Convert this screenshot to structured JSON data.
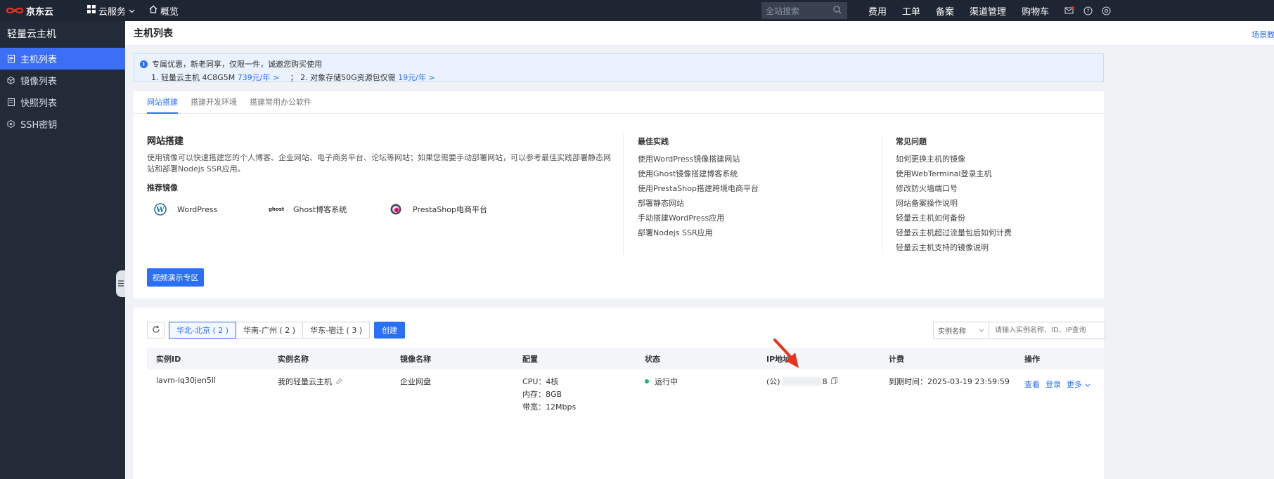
{
  "topbar": {
    "brand": "京东云",
    "cloud_services": "云服务",
    "overview": "概览",
    "search_placeholder": "全站搜索",
    "links": [
      "费用",
      "工单",
      "备案",
      "渠道管理",
      "购物车"
    ]
  },
  "sidebar": {
    "title": "轻量云主机",
    "items": [
      {
        "label": "主机列表",
        "icon": "host-list-icon"
      },
      {
        "label": "镜像列表",
        "icon": "image-icon"
      },
      {
        "label": "快照列表",
        "icon": "snapshot-icon"
      },
      {
        "label": "SSH密钥",
        "icon": "key-icon"
      }
    ]
  },
  "header": {
    "title": "主机列表",
    "scene_link": "场景教程"
  },
  "notice": {
    "line1": "专属优惠，新老同享，仅限一件，诚邀您购买使用",
    "item1_prefix": "1. 轻量云主机 4C8G5M ",
    "item1_price": "739元/年 >",
    "sep": "；",
    "item2_prefix": " 2. 对象存储50G资源包仅需 ",
    "item2_price": "19元/年 >"
  },
  "tabs": [
    "网站搭建",
    "搭建开发环境",
    "搭建常用办公软件"
  ],
  "website": {
    "title": "网站搭建",
    "desc": "使用镜像可以快速搭建您的个人博客、企业网站、电子商务平台、论坛等网站；如果您需要手动部署网站，可以参考最佳实践部署静态网站和部署Nodejs SSR应用。",
    "recommend_title": "推荐镜像",
    "images": [
      {
        "name": "WordPress",
        "logo_text": ""
      },
      {
        "name": "Ghost博客系统",
        "logo_text": "ghost"
      },
      {
        "name": "PrestaShop电商平台",
        "logo_text": ""
      }
    ],
    "video_button": "视频演示专区"
  },
  "best_practices": {
    "title": "最佳实践",
    "links": [
      "使用WordPress镜像搭建网站",
      "使用Ghost镜像搭建博客系统",
      "使用PrestaShop搭建跨境电商平台",
      "部署静态网站",
      "手动搭建WordPress应用",
      "部署Nodejs SSR应用"
    ]
  },
  "faq": {
    "title": "常见问题",
    "links": [
      "如何更换主机的镜像",
      "使用WebTerminal登录主机",
      "修改防火墙端口号",
      "网站备案操作说明",
      "轻量云主机如何备份",
      "轻量云主机超过流量包后如何计费",
      "轻量云主机支持的镜像说明"
    ]
  },
  "instances": {
    "regions": [
      "华北-北京 ( 2 )",
      "华南-广州 ( 2 )",
      "华东-宿迁 ( 3 )"
    ],
    "create": "创建",
    "filter_select": "实例名称",
    "search_placeholder": "请输入实例名称、ID、IP查询",
    "columns": [
      "实例ID",
      "实例名称",
      "镜像名称",
      "配置",
      "状态",
      "IP地址",
      "计费",
      "操作"
    ],
    "rows": [
      {
        "id": "lavm-lq30jen5ll",
        "name": "我的轻量云主机",
        "image": "企业网盘",
        "cpu": "CPU：4核",
        "mem": "内存：8GB",
        "bw": "带宽：12Mbps",
        "status": "运行中",
        "ip_prefix": "(公)",
        "ip_suffix": "8",
        "billing": "到期时间：2025-03-19 23:59:59",
        "ops": [
          "查看",
          "登录",
          "更多"
        ]
      }
    ]
  },
  "colors": {
    "accent": "#2a6ff5",
    "topbar": "#1f2633",
    "sidebar": "#232b38",
    "running": "#23b26d",
    "arrow": "#e8321e"
  }
}
